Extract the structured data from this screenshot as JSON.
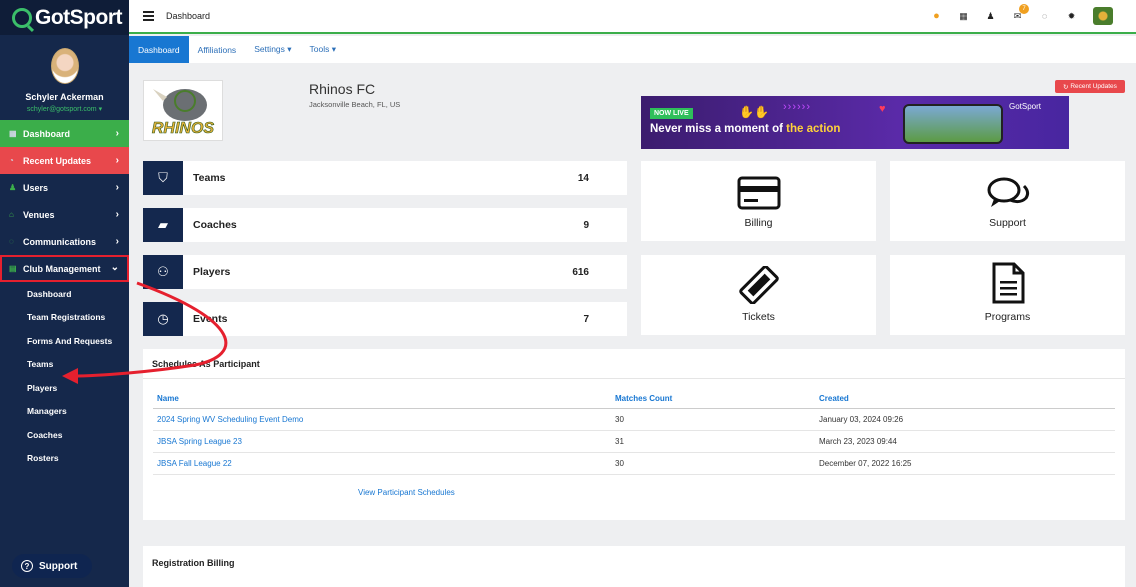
{
  "brand": {
    "name": "GotSport"
  },
  "profile": {
    "name": "Schyler Ackerman",
    "email": "schyler@gotsport.com"
  },
  "sidebar": {
    "items": [
      {
        "label": "Dashboard",
        "icon": "dashboard-icon"
      },
      {
        "label": "Recent Updates",
        "icon": "bell-icon"
      },
      {
        "label": "Users",
        "icon": "users-icon"
      },
      {
        "label": "Venues",
        "icon": "venue-icon"
      },
      {
        "label": "Communications",
        "icon": "chat-icon"
      },
      {
        "label": "Club Management",
        "icon": "club-icon"
      }
    ],
    "sub_items": [
      "Dashboard",
      "Team Registrations",
      "Forms And Requests",
      "Teams",
      "Players",
      "Managers",
      "Coaches",
      "Rosters"
    ],
    "support_label": "Support"
  },
  "topbar": {
    "title": "Dashboard",
    "notification_count": "7"
  },
  "subnav": {
    "items": [
      "Dashboard",
      "Affiliations",
      "Settings ▾",
      "Tools ▾"
    ]
  },
  "club": {
    "name": "Rhinos FC",
    "location": "Jacksonville Beach, FL, US",
    "logo_text": "RHINOS"
  },
  "recent_updates_label": "Recent Updates",
  "banner": {
    "badge": "NOW LIVE",
    "text_a": "Never miss a moment of ",
    "text_b": "the action",
    "brand": "GotSport"
  },
  "stats": [
    {
      "label": "Teams",
      "value": "14",
      "icon": "shield-icon"
    },
    {
      "label": "Coaches",
      "value": "9",
      "icon": "book-icon"
    },
    {
      "label": "Players",
      "value": "616",
      "icon": "people-icon"
    },
    {
      "label": "Events",
      "value": "7",
      "icon": "clock-icon"
    }
  ],
  "tiles": [
    {
      "label": "Billing",
      "icon": "credit-card-icon"
    },
    {
      "label": "Support",
      "icon": "comments-icon"
    },
    {
      "label": "Tickets",
      "icon": "ticket-icon"
    },
    {
      "label": "Programs",
      "icon": "document-icon"
    }
  ],
  "schedules": {
    "title": "Schedules As Participant",
    "columns": [
      "Name",
      "Matches Count",
      "Created"
    ],
    "rows": [
      {
        "name": "2024 Spring WV Scheduling Event Demo",
        "matches": "30",
        "created": "January 03, 2024 09:26"
      },
      {
        "name": "JBSA Spring League 23",
        "matches": "31",
        "created": "March 23, 2023 09:44"
      },
      {
        "name": "JBSA Fall League 22",
        "matches": "30",
        "created": "December 07, 2022 16:25"
      }
    ],
    "view_link": "View Participant Schedules"
  },
  "registration_billing": {
    "title": "Registration Billing"
  },
  "colors": {
    "sidebar": "#15284b",
    "green": "#3bae4a",
    "red": "#e8484c",
    "blue": "#1877d2",
    "annotation": "#e5202e"
  }
}
